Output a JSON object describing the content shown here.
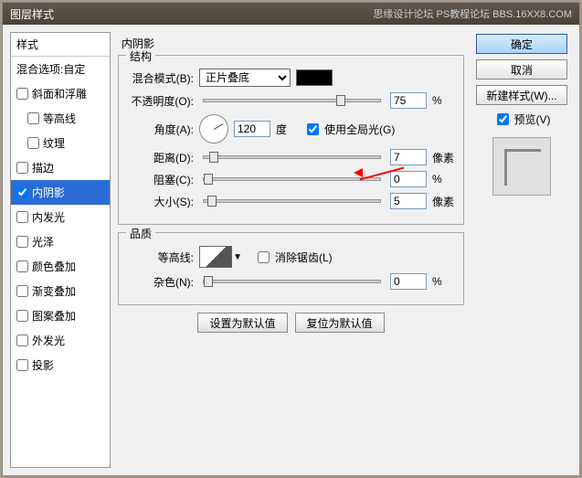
{
  "title": "图层样式",
  "watermark": "思缘设计论坛  PS教程论坛\nBBS.16XX8.COM",
  "left": {
    "header": "样式",
    "blending": "混合选项:自定",
    "items": [
      {
        "label": "斜面和浮雕",
        "checked": false
      },
      {
        "label": "等高线",
        "checked": false,
        "indent": true
      },
      {
        "label": "纹理",
        "checked": false,
        "indent": true
      },
      {
        "label": "描边",
        "checked": false
      },
      {
        "label": "内阴影",
        "checked": true,
        "selected": true
      },
      {
        "label": "内发光",
        "checked": false
      },
      {
        "label": "光泽",
        "checked": false
      },
      {
        "label": "颜色叠加",
        "checked": false
      },
      {
        "label": "渐变叠加",
        "checked": false
      },
      {
        "label": "图案叠加",
        "checked": false
      },
      {
        "label": "外发光",
        "checked": false
      },
      {
        "label": "投影",
        "checked": false
      }
    ]
  },
  "mid": {
    "panel_title": "内阴影",
    "structure": {
      "title": "结构",
      "blend_mode_label": "混合模式(B):",
      "blend_mode_value": "正片叠底",
      "opacity_label": "不透明度(O):",
      "opacity_value": "75",
      "opacity_unit": "%",
      "angle_label": "角度(A):",
      "angle_value": "120",
      "angle_unit": "度",
      "global_light": "使用全局光(G)",
      "distance_label": "距离(D):",
      "distance_value": "7",
      "distance_unit": "像素",
      "choke_label": "阻塞(C):",
      "choke_value": "0",
      "choke_unit": "%",
      "size_label": "大小(S):",
      "size_value": "5",
      "size_unit": "像素"
    },
    "quality": {
      "title": "品质",
      "contour_label": "等高线:",
      "antialias": "消除锯齿(L)",
      "noise_label": "杂色(N):",
      "noise_value": "0",
      "noise_unit": "%"
    },
    "btn_default": "设置为默认值",
    "btn_reset": "复位为默认值"
  },
  "right": {
    "ok": "确定",
    "cancel": "取消",
    "new_style": "新建样式(W)...",
    "preview_label": "预览(V)"
  }
}
